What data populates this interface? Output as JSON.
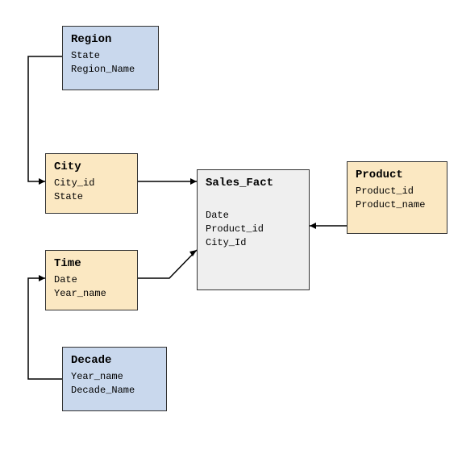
{
  "nodes": {
    "region": {
      "title": "Region",
      "attr1": "State",
      "attr2": "Region_Name"
    },
    "city": {
      "title": "City",
      "attr1": "City_id",
      "attr2": "State"
    },
    "time": {
      "title": "Time",
      "attr1": "Date",
      "attr2": "Year_name"
    },
    "decade": {
      "title": "Decade",
      "attr1": "Year_name",
      "attr2": "Decade_Name"
    },
    "salesfact": {
      "title": "Sales_Fact",
      "attr1": "Date",
      "attr2": "Product_id",
      "attr3": "City_Id"
    },
    "product": {
      "title": "Product",
      "attr1": "Product_id",
      "attr2": "Product_name"
    }
  }
}
